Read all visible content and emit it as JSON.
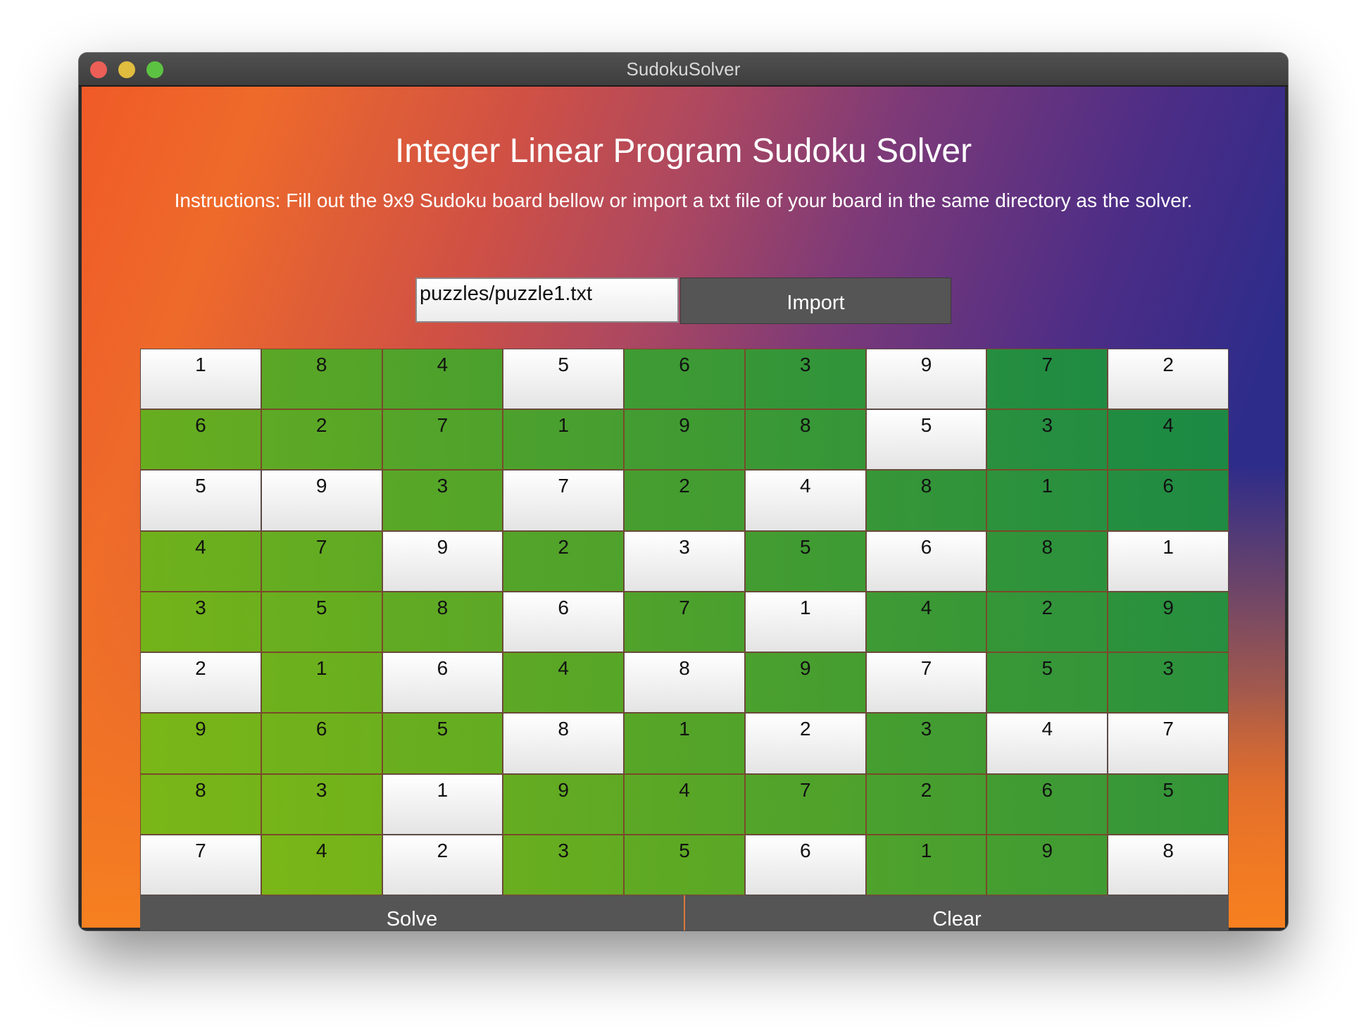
{
  "window": {
    "title": "SudokuSolver"
  },
  "app": {
    "heading": "Integer Linear Program Sudoku Solver",
    "instructions": "Instructions: Fill out the 9x9 Sudoku board bellow or import a txt file of your board in the same directory as the solver."
  },
  "import": {
    "file_path": "puzzles/puzzle1.txt",
    "button_label": "Import"
  },
  "board": {
    "rows": [
      [
        "1",
        "8",
        "4",
        "5",
        "6",
        "3",
        "9",
        "7",
        "2"
      ],
      [
        "6",
        "2",
        "7",
        "1",
        "9",
        "8",
        "5",
        "3",
        "4"
      ],
      [
        "5",
        "9",
        "3",
        "7",
        "2",
        "4",
        "8",
        "1",
        "6"
      ],
      [
        "4",
        "7",
        "9",
        "2",
        "3",
        "5",
        "6",
        "8",
        "1"
      ],
      [
        "3",
        "5",
        "8",
        "6",
        "7",
        "1",
        "4",
        "2",
        "9"
      ],
      [
        "2",
        "1",
        "6",
        "4",
        "8",
        "9",
        "7",
        "5",
        "3"
      ],
      [
        "9",
        "6",
        "5",
        "8",
        "1",
        "2",
        "3",
        "4",
        "7"
      ],
      [
        "8",
        "3",
        "1",
        "9",
        "4",
        "7",
        "2",
        "6",
        "5"
      ],
      [
        "7",
        "4",
        "2",
        "3",
        "5",
        "6",
        "1",
        "9",
        "8"
      ]
    ],
    "given_mask": [
      [
        1,
        0,
        0,
        1,
        0,
        0,
        1,
        0,
        1
      ],
      [
        0,
        0,
        0,
        0,
        0,
        0,
        1,
        0,
        0
      ],
      [
        1,
        1,
        0,
        1,
        0,
        1,
        0,
        0,
        0
      ],
      [
        0,
        0,
        1,
        0,
        1,
        0,
        1,
        0,
        1
      ],
      [
        0,
        0,
        0,
        1,
        0,
        1,
        0,
        0,
        0
      ],
      [
        1,
        0,
        1,
        0,
        1,
        0,
        1,
        0,
        0
      ],
      [
        0,
        0,
        0,
        1,
        0,
        1,
        0,
        1,
        1
      ],
      [
        0,
        0,
        1,
        0,
        0,
        0,
        0,
        0,
        0
      ],
      [
        1,
        0,
        1,
        0,
        0,
        1,
        0,
        0,
        1
      ]
    ],
    "colors": {
      "given_top": "#ffffff",
      "given_bottom": "#e4e4e4",
      "solved_light": "#7ab617",
      "solved_dark": "#1c8a44"
    }
  },
  "actions": {
    "solve_label": "Solve",
    "clear_label": "Clear"
  }
}
